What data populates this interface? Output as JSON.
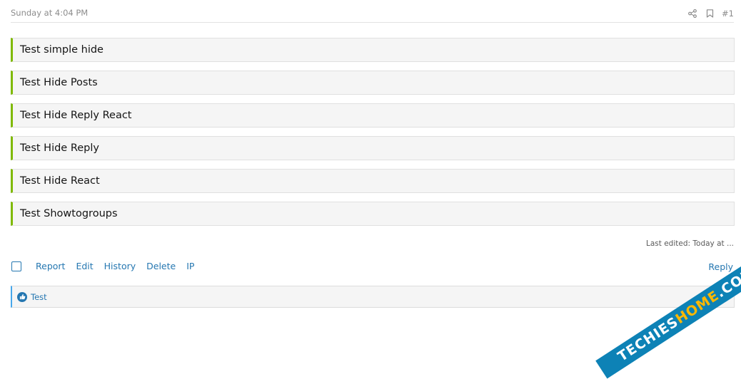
{
  "post": {
    "date": "Sunday at 4:04 PM",
    "number": "#1",
    "share_icon": "share-icon",
    "bookmark_icon": "bookmark-icon"
  },
  "hide_blocks": [
    "Test simple hide",
    "Test Hide Posts",
    "Test Hide Reply React",
    "Test Hide Reply",
    "Test Hide React",
    "Test Showtogroups"
  ],
  "last_edited": "Last edited: Today at ...",
  "actions": {
    "report": "Report",
    "edit": "Edit",
    "history": "History",
    "delete": "Delete",
    "ip": "IP",
    "reply": "Reply"
  },
  "reactions": {
    "icon": "like-icon",
    "users": "Test"
  },
  "watermark": {
    "part1": "TECHIES",
    "part2": "HOME",
    "part3": ".COM"
  },
  "colors": {
    "accent": "#2577b1",
    "hide_border": "#7fb900",
    "reaction_border": "#47a7eb"
  }
}
